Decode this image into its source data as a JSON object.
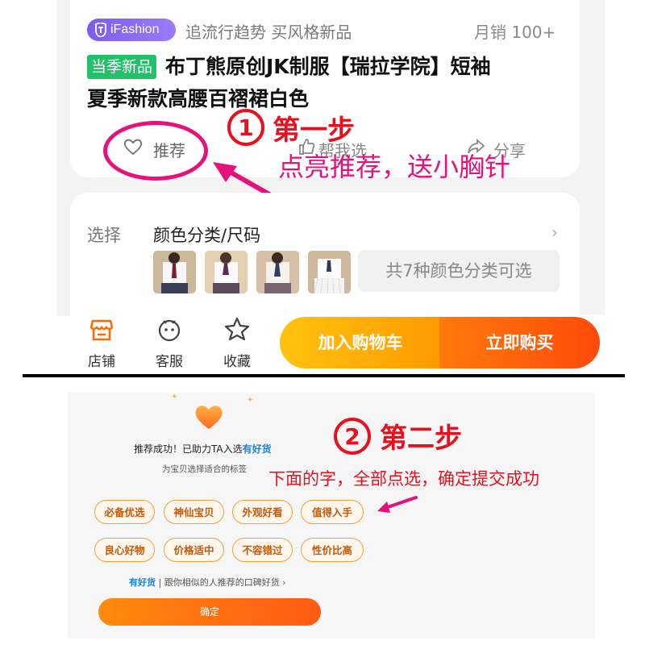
{
  "product": {
    "brand_badge": "iFashion",
    "brand_slogan": "追流行趋势 买风格新品",
    "monthly_sales": "月销  100+",
    "new_tag": "当季新品",
    "title_line1": "布丁熊原创JK制服【瑞拉学院】短袖",
    "title_line2": "夏季新款高腰百褶裙白色",
    "actions": {
      "recommend": "推荐",
      "help_choose": "帮我选",
      "share": "分享"
    }
  },
  "step1": {
    "number": "①",
    "title": "第一步",
    "description": "点亮推荐，送小胸针"
  },
  "selection": {
    "label": "选择",
    "value": "颜色分类/尺码",
    "chevron": "›",
    "colors_hint": "共7种颜色分类可选",
    "thumbnails": [
      "uniform-1",
      "uniform-2",
      "uniform-3",
      "uniform-4"
    ]
  },
  "bottom_bar": {
    "shop": "店铺",
    "service": "客服",
    "favorite": "收藏",
    "add_to_cart": "加入购物车",
    "buy_now": "立即购买"
  },
  "step2": {
    "number": "②",
    "title": "第二步",
    "description": "下面的字，全部点选，确定提交成功",
    "success_prefix": "推荐成功！已助力TA入选",
    "success_highlight": "有好货",
    "tag_hint": "为宝贝选择适合的标签",
    "tags": [
      "必备优选",
      "神仙宝贝",
      "外观好看",
      "值得入手",
      "良心好物",
      "价格适中",
      "不容错过",
      "性价比高"
    ],
    "more_highlight": "有好货",
    "more_text": " | 跟你相似的人推荐的口碑好货 ›",
    "confirm": "确定"
  },
  "colors": {
    "brand_purple": "#8a6bf4",
    "new_green": "#23c06a",
    "annotation_magenta": "#e6117b",
    "annotation_red": "#e8101e",
    "cart_yellow": "#ffb30a",
    "buy_orange": "#ff5a0a",
    "tag_border": "#f0a03a",
    "link_blue": "#1b82d8"
  }
}
